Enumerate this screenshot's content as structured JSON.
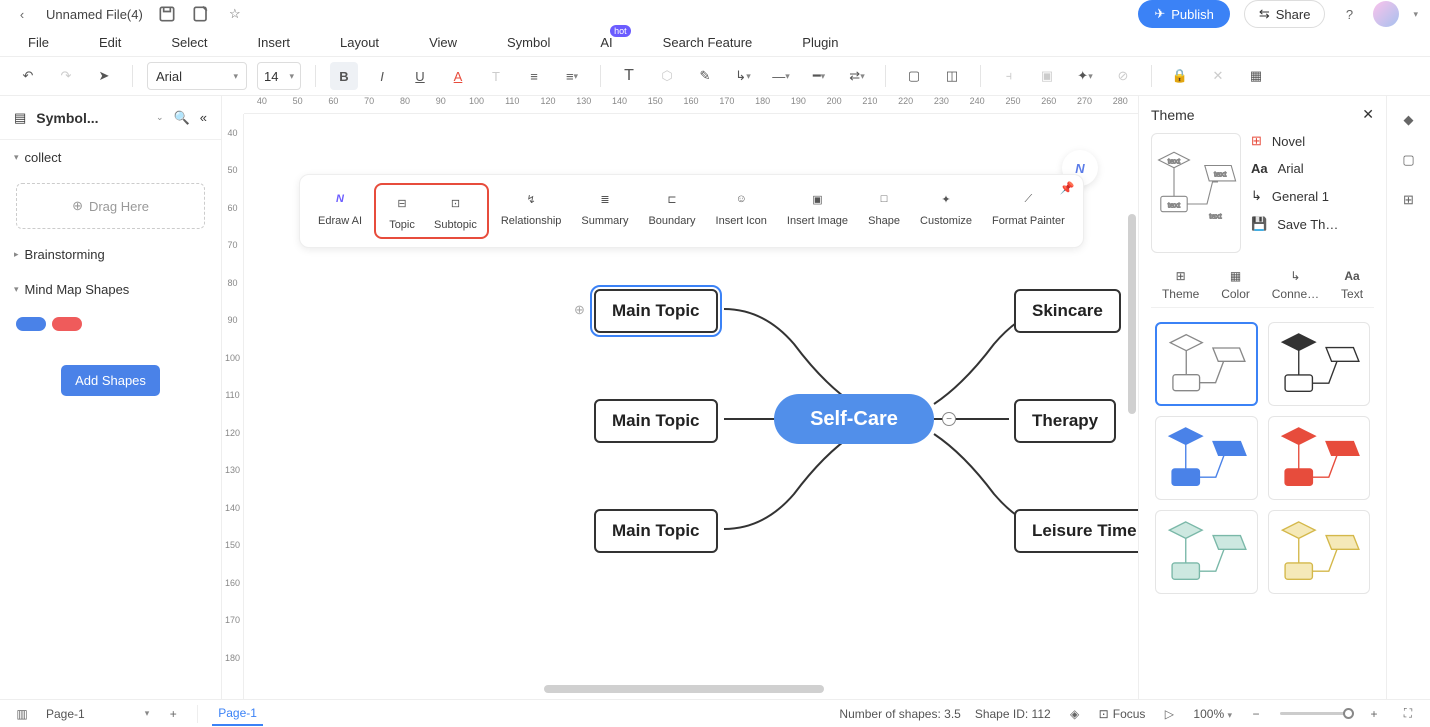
{
  "title": {
    "filename": "Unnamed File(4)"
  },
  "menu": {
    "file": "File",
    "edit": "Edit",
    "select": "Select",
    "insert": "Insert",
    "layout": "Layout",
    "view": "View",
    "symbol": "Symbol",
    "ai": "AI",
    "ai_badge": "hot",
    "search": "Search Feature",
    "plugin": "Plugin"
  },
  "actions": {
    "publish": "Publish",
    "share": "Share"
  },
  "toolbar": {
    "font": "Arial",
    "size": "14"
  },
  "sidebar": {
    "title": "Symbol...",
    "collect": "collect",
    "drag": "Drag Here",
    "brainstorm": "Brainstorming",
    "mindmap": "Mind Map Shapes",
    "add": "Add Shapes"
  },
  "ruler_h": [
    "40",
    "50",
    "60",
    "70",
    "80",
    "90",
    "100",
    "110",
    "120",
    "130",
    "140",
    "150",
    "160",
    "170",
    "180",
    "190",
    "200",
    "210",
    "220",
    "230",
    "240",
    "250",
    "260",
    "270",
    "280"
  ],
  "ruler_v": [
    "40",
    "50",
    "60",
    "70",
    "80",
    "90",
    "100",
    "110",
    "120",
    "130",
    "140",
    "150",
    "160",
    "170",
    "180"
  ],
  "float": {
    "edraw": "Edraw AI",
    "topic": "Topic",
    "subtopic": "Subtopic",
    "relationship": "Relationship",
    "summary": "Summary",
    "boundary": "Boundary",
    "icon": "Insert Icon",
    "image": "Insert Image",
    "shape": "Shape",
    "customize": "Customize",
    "painter": "Format Painter"
  },
  "mindmap": {
    "center": "Self-Care",
    "l1": "Main Topic",
    "l2": "Main Topic",
    "l3": "Main Topic",
    "r1": "Skincare",
    "r2": "Therapy",
    "r3": "Leisure Time"
  },
  "rpanel": {
    "title": "Theme",
    "novel": "Novel",
    "font": "Arial",
    "general": "General 1",
    "save": "Save Th…",
    "tab_theme": "Theme",
    "tab_color": "Color",
    "tab_conn": "Conne…",
    "tab_text": "Text",
    "thumb_text": "text"
  },
  "status": {
    "page_sel": "Page-1",
    "page_tab": "Page-1",
    "shapes": "Number of shapes: 3.5",
    "shapeid": "Shape ID: 112",
    "focus": "Focus",
    "zoom": "100%"
  }
}
